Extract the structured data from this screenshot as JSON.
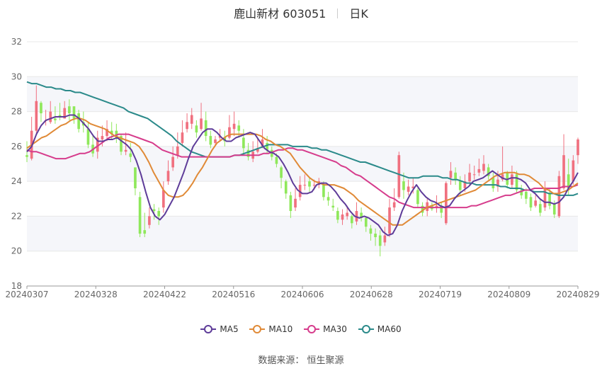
{
  "title": {
    "name": "鹿山新材 603051",
    "period": "日K"
  },
  "source": "数据来源： 恒生聚源",
  "colors": {
    "up": "#f0707f",
    "down": "#8fe85b",
    "ma5": "#5e3c99",
    "ma10": "#e08a37",
    "ma30": "#d63c8c",
    "ma60": "#2b8a8a",
    "grid": "#e8e8e8",
    "band": "#f5f6fa"
  },
  "chart_data": {
    "type": "candlestick",
    "ylim": [
      18,
      32
    ],
    "y_ticks": [
      18,
      20,
      22,
      24,
      26,
      28,
      30,
      32
    ],
    "x_ticks": [
      "20240307",
      "20240328",
      "20240422",
      "20240516",
      "20240606",
      "20240628",
      "20240719",
      "20240809",
      "20240829"
    ],
    "legend": [
      "MA5",
      "MA10",
      "MA30",
      "MA60"
    ],
    "candles": [
      [
        25.5,
        25.4,
        26.3,
        25.1
      ],
      [
        25.3,
        26.9,
        27.7,
        25.2
      ],
      [
        26.9,
        28.6,
        29.5,
        26.7
      ],
      [
        28.5,
        27.9,
        28.6,
        27.4
      ],
      [
        27.5,
        27.5,
        28.1,
        27.2
      ],
      [
        27.4,
        28.0,
        28.6,
        27.3
      ],
      [
        27.6,
        27.5,
        28.3,
        27.3
      ],
      [
        27.8,
        27.7,
        28.5,
        27.5
      ],
      [
        27.6,
        28.2,
        28.6,
        27.6
      ],
      [
        28.3,
        27.9,
        28.7,
        27.5
      ],
      [
        28.3,
        27.6,
        28.3,
        27.3
      ],
      [
        27.9,
        27.0,
        28.1,
        26.8
      ],
      [
        27.4,
        27.2,
        28.0,
        26.8
      ],
      [
        27.0,
        26.1,
        27.4,
        25.9
      ],
      [
        26.1,
        25.6,
        26.6,
        25.4
      ],
      [
        25.7,
        26.5,
        26.9,
        25.3
      ],
      [
        26.4,
        26.6,
        27.2,
        26.0
      ],
      [
        26.6,
        27.0,
        27.5,
        26.3
      ],
      [
        26.9,
        26.7,
        27.4,
        26.4
      ],
      [
        26.9,
        26.5,
        27.3,
        26.2
      ],
      [
        26.6,
        25.7,
        26.7,
        25.5
      ],
      [
        25.7,
        25.8,
        26.8,
        25.5
      ],
      [
        25.6,
        25.4,
        26.2,
        25.1
      ],
      [
        24.8,
        23.6,
        24.8,
        23.2
      ],
      [
        23.1,
        21.0,
        23.4,
        20.8
      ],
      [
        21.2,
        21.0,
        22.2,
        20.8
      ],
      [
        21.5,
        22.0,
        22.5,
        21.3
      ],
      [
        22.4,
        22.3,
        22.7,
        21.8
      ],
      [
        22.3,
        22.0,
        22.5,
        21.5
      ],
      [
        22.5,
        23.5,
        24.0,
        22.2
      ],
      [
        24.0,
        24.6,
        25.2,
        23.8
      ],
      [
        24.8,
        25.4,
        26.0,
        24.6
      ],
      [
        25.5,
        26.0,
        26.8,
        25.3
      ],
      [
        26.2,
        26.8,
        27.5,
        26.0
      ],
      [
        27.0,
        27.4,
        27.9,
        26.8
      ],
      [
        27.3,
        27.8,
        28.2,
        27.0
      ],
      [
        27.2,
        26.8,
        27.5,
        26.5
      ],
      [
        27.0,
        27.6,
        28.5,
        26.9
      ],
      [
        27.5,
        26.6,
        28.0,
        26.3
      ],
      [
        26.6,
        26.1,
        26.9,
        25.9
      ],
      [
        26.2,
        26.4,
        26.6,
        26.0
      ],
      [
        26.5,
        26.6,
        27.0,
        26.3
      ],
      [
        26.5,
        26.3,
        26.9,
        26.0
      ],
      [
        26.5,
        27.1,
        27.8,
        26.4
      ],
      [
        27.0,
        27.3,
        28.0,
        26.6
      ],
      [
        27.2,
        26.9,
        27.5,
        26.5
      ],
      [
        26.5,
        25.9,
        27.0,
        25.5
      ],
      [
        25.8,
        25.4,
        26.2,
        25.2
      ],
      [
        25.3,
        25.7,
        26.3,
        25.1
      ],
      [
        25.7,
        25.9,
        26.5,
        25.6
      ],
      [
        26.0,
        26.4,
        27.0,
        25.9
      ],
      [
        26.2,
        25.8,
        26.6,
        25.6
      ],
      [
        25.8,
        25.4,
        26.0,
        25.2
      ],
      [
        25.4,
        25.0,
        25.6,
        24.8
      ],
      [
        24.8,
        24.2,
        24.9,
        23.6
      ],
      [
        24.0,
        23.3,
        24.1,
        23.0
      ],
      [
        23.2,
        22.3,
        23.4,
        21.9
      ],
      [
        22.5,
        23.0,
        23.6,
        22.3
      ],
      [
        23.1,
        23.8,
        24.3,
        22.9
      ],
      [
        23.8,
        23.8,
        24.4,
        23.5
      ],
      [
        24.0,
        23.7,
        24.2,
        23.4
      ],
      [
        23.8,
        23.8,
        24.1,
        23.5
      ],
      [
        23.8,
        24.0,
        24.2,
        23.6
      ],
      [
        23.8,
        23.1,
        24.0,
        22.9
      ],
      [
        23.1,
        22.9,
        23.4,
        22.6
      ],
      [
        22.6,
        22.5,
        23.0,
        22.3
      ],
      [
        22.3,
        21.8,
        22.5,
        21.6
      ],
      [
        21.8,
        22.1,
        22.4,
        21.5
      ],
      [
        22.0,
        22.2,
        22.6,
        21.8
      ],
      [
        22.0,
        21.6,
        22.1,
        21.3
      ],
      [
        21.7,
        22.3,
        22.8,
        21.5
      ],
      [
        22.2,
        21.9,
        22.5,
        21.7
      ],
      [
        21.9,
        21.4,
        22.0,
        21.1
      ],
      [
        21.3,
        21.0,
        21.5,
        20.6
      ],
      [
        21.0,
        20.8,
        21.3,
        20.3
      ],
      [
        20.9,
        20.3,
        21.2,
        19.7
      ],
      [
        20.5,
        20.9,
        21.4,
        20.3
      ],
      [
        21.0,
        22.5,
        23.0,
        20.8
      ],
      [
        22.5,
        22.8,
        23.6,
        22.3
      ],
      [
        23.1,
        25.5,
        25.7,
        23.0
      ],
      [
        24.0,
        23.5,
        24.5,
        23.0
      ],
      [
        23.4,
        23.7,
        24.1,
        23.2
      ],
      [
        23.6,
        23.7,
        24.2,
        23.3
      ],
      [
        23.5,
        22.7,
        23.6,
        22.5
      ],
      [
        22.6,
        22.2,
        22.8,
        22.0
      ],
      [
        22.3,
        22.8,
        23.0,
        22.0
      ],
      [
        22.6,
        22.4,
        22.8,
        22.3
      ],
      [
        22.5,
        22.6,
        23.2,
        22.2
      ],
      [
        22.6,
        22.2,
        22.8,
        21.9
      ],
      [
        21.6,
        23.9,
        24.0,
        21.5
      ],
      [
        24.2,
        24.6,
        25.1,
        23.8
      ],
      [
        24.5,
        24.1,
        24.8,
        23.8
      ],
      [
        24.0,
        23.5,
        24.3,
        23.2
      ],
      [
        23.6,
        24.0,
        24.4,
        23.4
      ],
      [
        24.0,
        24.5,
        25.0,
        23.8
      ],
      [
        24.4,
        24.4,
        24.9,
        24.1
      ],
      [
        24.5,
        24.7,
        25.3,
        24.3
      ],
      [
        24.6,
        25.0,
        25.5,
        24.4
      ],
      [
        24.8,
        24.3,
        25.0,
        24.1
      ],
      [
        24.2,
        23.6,
        24.5,
        23.4
      ],
      [
        23.7,
        24.1,
        24.6,
        23.4
      ],
      [
        24.1,
        24.4,
        26.0,
        24.0
      ],
      [
        24.5,
        23.8,
        24.6,
        23.6
      ],
      [
        23.8,
        24.4,
        24.9,
        23.6
      ],
      [
        24.4,
        23.5,
        24.6,
        23.3
      ],
      [
        23.5,
        23.2,
        23.8,
        23.0
      ],
      [
        23.4,
        23.0,
        23.6,
        22.7
      ],
      [
        23.1,
        22.5,
        23.3,
        22.3
      ],
      [
        22.6,
        22.9,
        23.2,
        22.5
      ],
      [
        22.7,
        22.2,
        23.0,
        22.0
      ],
      [
        22.5,
        23.6,
        24.0,
        22.3
      ],
      [
        23.3,
        22.6,
        23.6,
        22.4
      ],
      [
        22.7,
        22.1,
        22.9,
        21.9
      ],
      [
        22.0,
        24.3,
        24.6,
        21.9
      ],
      [
        23.6,
        25.5,
        26.7,
        23.5
      ],
      [
        24.4,
        23.6,
        25.3,
        23.2
      ],
      [
        24.0,
        25.2,
        25.5,
        23.8
      ],
      [
        25.5,
        26.4,
        26.5,
        25.0
      ]
    ],
    "ma5": [
      25.7,
      26.0,
      26.7,
      27.2,
      27.5,
      27.6,
      27.7,
      27.7,
      27.7,
      27.8,
      27.8,
      27.6,
      27.3,
      27.0,
      26.6,
      26.3,
      26.3,
      26.4,
      26.4,
      26.5,
      26.3,
      26.1,
      25.8,
      25.2,
      24.4,
      23.4,
      22.5,
      22.0,
      21.8,
      22.1,
      22.6,
      23.1,
      23.8,
      24.5,
      25.3,
      26.0,
      26.4,
      26.8,
      27.0,
      27.0,
      26.8,
      26.5,
      26.3,
      26.3,
      26.5,
      26.6,
      26.7,
      26.8,
      26.7,
      26.3,
      25.9,
      25.7,
      25.6,
      25.4,
      25.0,
      24.5,
      23.9,
      23.5,
      23.3,
      23.3,
      23.4,
      23.8,
      23.9,
      23.9,
      23.7,
      23.4,
      23.0,
      22.7,
      22.3,
      22.0,
      21.9,
      22.0,
      21.9,
      21.7,
      21.5,
      21.1,
      20.9,
      21.0,
      21.5,
      22.3,
      22.9,
      23.4,
      23.8,
      23.4,
      23.1,
      22.9,
      22.8,
      22.6,
      22.5,
      22.6,
      23.0,
      23.3,
      23.5,
      23.7,
      24.0,
      24.1,
      24.2,
      24.4,
      24.6,
      24.4,
      24.2,
      24.1,
      24.2,
      24.2,
      24.1,
      23.9,
      23.5,
      23.3,
      23.0,
      22.8,
      22.8,
      22.7,
      22.8,
      23.1,
      23.6,
      24.0,
      24.5
    ],
    "ma10": [
      25.9,
      26.1,
      26.3,
      26.5,
      26.6,
      26.8,
      27.0,
      27.2,
      27.3,
      27.5,
      27.6,
      27.6,
      27.5,
      27.3,
      27.2,
      27.1,
      27.0,
      26.8,
      26.6,
      26.5,
      26.4,
      26.3,
      26.2,
      26.0,
      25.6,
      25.1,
      24.5,
      24.0,
      23.5,
      23.2,
      23.1,
      23.1,
      23.2,
      23.5,
      23.9,
      24.4,
      24.8,
      25.3,
      25.8,
      26.2,
      26.4,
      26.6,
      26.7,
      26.7,
      26.7,
      26.7,
      26.7,
      26.7,
      26.6,
      26.4,
      26.3,
      26.1,
      26.0,
      25.8,
      25.6,
      25.2,
      24.8,
      24.5,
      24.2,
      24.0,
      23.9,
      23.8,
      23.8,
      23.8,
      23.7,
      23.6,
      23.4,
      23.2,
      22.9,
      22.7,
      22.5,
      22.3,
      22.1,
      21.9,
      21.7,
      21.5,
      21.5,
      21.5,
      21.7,
      21.9,
      22.1,
      22.3,
      22.5,
      22.6,
      22.7,
      22.8,
      22.9,
      23.0,
      23.1,
      23.2,
      23.3,
      23.4,
      23.5,
      23.7,
      23.9,
      24.1,
      24.3,
      24.4,
      24.5,
      24.5,
      24.5,
      24.4,
      24.4,
      24.3,
      24.1,
      23.9,
      23.6,
      23.5,
      23.3,
      23.3,
      23.4,
      23.5,
      23.7,
      23.9
    ],
    "ma30": [
      25.8,
      25.7,
      25.7,
      25.6,
      25.5,
      25.4,
      25.3,
      25.3,
      25.3,
      25.4,
      25.5,
      25.6,
      25.6,
      25.7,
      25.9,
      26.1,
      26.3,
      26.5,
      26.6,
      26.7,
      26.7,
      26.7,
      26.6,
      26.5,
      26.4,
      26.3,
      26.2,
      26.0,
      25.8,
      25.7,
      25.6,
      25.5,
      25.4,
      25.4,
      25.4,
      25.4,
      25.4,
      25.4,
      25.4,
      25.4,
      25.4,
      25.4,
      25.4,
      25.5,
      25.5,
      25.5,
      25.5,
      25.5,
      25.5,
      25.6,
      25.6,
      25.7,
      25.8,
      25.8,
      25.9,
      25.9,
      25.8,
      25.8,
      25.7,
      25.6,
      25.5,
      25.4,
      25.3,
      25.2,
      25.1,
      24.9,
      24.8,
      24.6,
      24.4,
      24.3,
      24.1,
      23.9,
      23.7,
      23.5,
      23.3,
      23.1,
      23.0,
      22.8,
      22.7,
      22.6,
      22.5,
      22.5,
      22.5,
      22.5,
      22.5,
      22.5,
      22.5,
      22.5,
      22.5,
      22.5,
      22.5,
      22.5,
      22.6,
      22.6,
      22.7,
      22.8,
      22.9,
      23.0,
      23.1,
      23.2,
      23.2,
      23.3,
      23.4,
      23.5,
      23.5,
      23.6,
      23.6,
      23.6,
      23.6,
      23.6,
      23.6,
      23.7,
      23.7,
      23.7,
      23.8
    ],
    "ma60": [
      29.7,
      29.6,
      29.6,
      29.5,
      29.4,
      29.4,
      29.3,
      29.3,
      29.2,
      29.2,
      29.1,
      29.1,
      29.0,
      28.9,
      28.8,
      28.7,
      28.6,
      28.5,
      28.4,
      28.3,
      28.2,
      28.0,
      27.9,
      27.8,
      27.7,
      27.6,
      27.4,
      27.2,
      27.0,
      26.8,
      26.6,
      26.3,
      26.1,
      25.9,
      25.7,
      25.6,
      25.5,
      25.4,
      25.4,
      25.4,
      25.4,
      25.4,
      25.4,
      25.5,
      25.5,
      25.6,
      25.7,
      25.8,
      25.9,
      26.0,
      26.1,
      26.1,
      26.1,
      26.1,
      26.1,
      26.0,
      26.0,
      26.0,
      26.0,
      25.9,
      25.9,
      25.8,
      25.8,
      25.7,
      25.6,
      25.5,
      25.4,
      25.3,
      25.2,
      25.1,
      25.1,
      25.0,
      24.9,
      24.8,
      24.7,
      24.6,
      24.5,
      24.4,
      24.3,
      24.2,
      24.2,
      24.2,
      24.3,
      24.3,
      24.3,
      24.3,
      24.2,
      24.2,
      24.1,
      24.1,
      24.0,
      23.9,
      23.9,
      23.8,
      23.8,
      23.8,
      23.8,
      23.8,
      23.7,
      23.7,
      23.6,
      23.6,
      23.6,
      23.5,
      23.5,
      23.4,
      23.4,
      23.4,
      23.3,
      23.3,
      23.2,
      23.2,
      23.2,
      23.2,
      23.3
    ]
  }
}
